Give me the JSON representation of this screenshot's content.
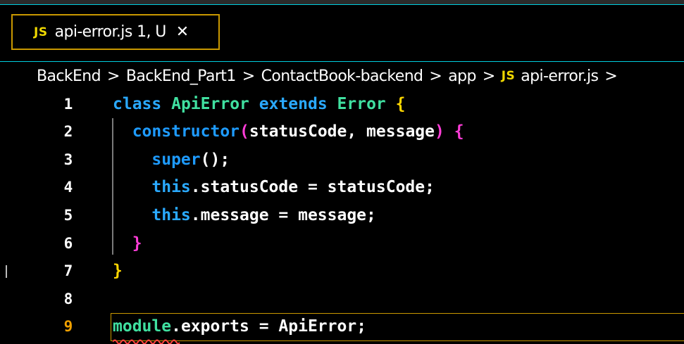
{
  "tab": {
    "badge": "JS",
    "title": "api-error.js 1, U",
    "close_glyph": "✕"
  },
  "breadcrumb": {
    "items": [
      "BackEnd",
      "BackEnd_Part1",
      "ContactBook-backend",
      "app"
    ],
    "file_badge": "JS",
    "file": "api-error.js",
    "separator": ">"
  },
  "editor": {
    "active_line": 9,
    "line_numbers": [
      "1",
      "2",
      "3",
      "4",
      "5",
      "6",
      "7",
      "8",
      "9"
    ],
    "lines": [
      {
        "tokens": [
          {
            "t": "class",
            "c": "kw"
          },
          {
            "t": " ",
            "c": "plain"
          },
          {
            "t": "ApiError",
            "c": "type"
          },
          {
            "t": " ",
            "c": "plain"
          },
          {
            "t": "extends",
            "c": "kw"
          },
          {
            "t": " ",
            "c": "plain"
          },
          {
            "t": "Error",
            "c": "type"
          },
          {
            "t": " ",
            "c": "plain"
          },
          {
            "t": "{",
            "c": "b1"
          }
        ]
      },
      {
        "tokens": [
          {
            "t": "  ",
            "c": "plain"
          },
          {
            "t": "constructor",
            "c": "fn"
          },
          {
            "t": "(",
            "c": "b2"
          },
          {
            "t": "statusCode, message",
            "c": "plain"
          },
          {
            "t": ")",
            "c": "b2"
          },
          {
            "t": " ",
            "c": "plain"
          },
          {
            "t": "{",
            "c": "b2"
          }
        ]
      },
      {
        "tokens": [
          {
            "t": "    ",
            "c": "plain"
          },
          {
            "t": "super",
            "c": "fn"
          },
          {
            "t": "();",
            "c": "plain"
          }
        ]
      },
      {
        "tokens": [
          {
            "t": "    ",
            "c": "plain"
          },
          {
            "t": "this",
            "c": "this"
          },
          {
            "t": ".statusCode = statusCode;",
            "c": "plain"
          }
        ]
      },
      {
        "tokens": [
          {
            "t": "    ",
            "c": "plain"
          },
          {
            "t": "this",
            "c": "this"
          },
          {
            "t": ".message = message;",
            "c": "plain"
          }
        ]
      },
      {
        "tokens": [
          {
            "t": "  ",
            "c": "plain"
          },
          {
            "t": "}",
            "c": "b2"
          }
        ]
      },
      {
        "tokens": [
          {
            "t": "}",
            "c": "b1"
          }
        ]
      },
      {
        "tokens": []
      },
      {
        "tokens": [
          {
            "t": "module",
            "c": "mod"
          },
          {
            "t": ".exports = ApiError;",
            "c": "plain"
          }
        ]
      }
    ]
  },
  "colors": {
    "accent_cyan": "#00cfe0",
    "active_border": "#c99800",
    "js_badge": "#f0d800",
    "error_squiggle": "#ff4040"
  },
  "icons": {
    "tab_file_icon": "js-file-icon",
    "breadcrumb_file_icon": "js-file-icon",
    "close": "close-icon"
  }
}
